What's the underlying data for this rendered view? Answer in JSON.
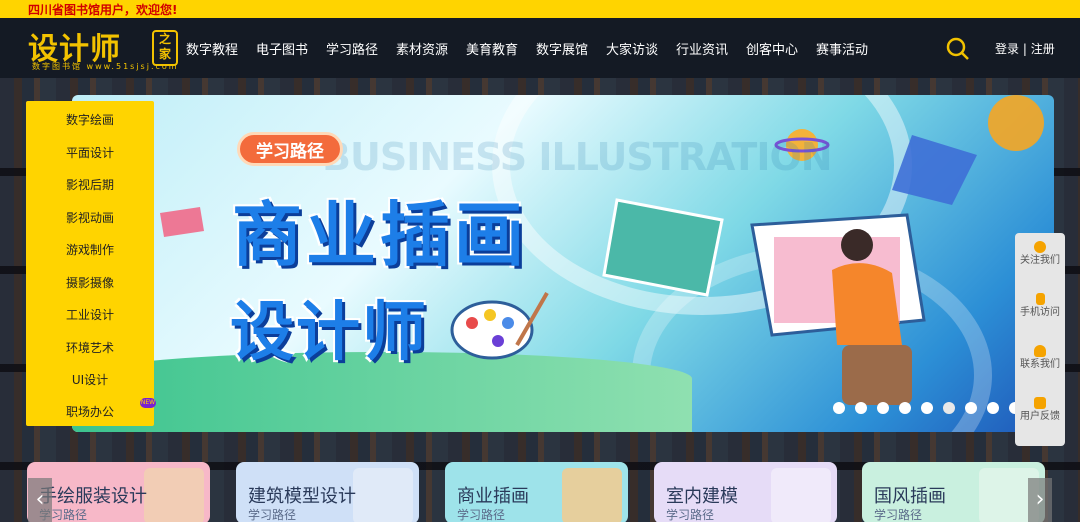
{
  "topbar": {
    "welcome": "四川省图书馆用户，欢迎您!"
  },
  "logo": {
    "main": "设计师",
    "jia": "之家",
    "sub": "数字图书馆 www.51sjsj.com"
  },
  "nav": [
    "数字教程",
    "电子图书",
    "学习路径",
    "素材资源",
    "美育教育",
    "数字展馆",
    "大家访谈",
    "行业资讯",
    "创客中心",
    "赛事活动"
  ],
  "auth": {
    "login": "登录",
    "separator": "|",
    "register": "注册"
  },
  "categories": [
    "数字绘画",
    "平面设计",
    "影视后期",
    "影视动画",
    "游戏制作",
    "摄影摄像",
    "工业设计",
    "环境艺术",
    "UI设计",
    "职场办公"
  ],
  "new_badge": "NEW",
  "banner": {
    "tag": "学习路径",
    "ghost": "BUSINESS ILLUSTRATION",
    "title_line1": "商业插画",
    "title_line2": "设计师",
    "slides": 9,
    "active_slide": 5
  },
  "floatbar": [
    {
      "icon": "chat-icon",
      "label": "关注我们"
    },
    {
      "icon": "phone-icon",
      "label": "手机访问"
    },
    {
      "icon": "user-icon",
      "label": "联系我们"
    },
    {
      "icon": "clipboard-icon",
      "label": "用户反馈"
    }
  ],
  "cards": [
    {
      "title": "手绘服装设计",
      "sub": "学习路径",
      "color": "#f7b8c8"
    },
    {
      "title": "建筑模型设计",
      "sub": "学习路径",
      "color": "#cfe0f7"
    },
    {
      "title": "商业插画",
      "sub": "学习路径",
      "color": "#9ee3ea"
    },
    {
      "title": "室内建模",
      "sub": "学习路径",
      "color": "#e6dcf7"
    },
    {
      "title": "国风插画",
      "sub": "学习路径",
      "color": "#c9f0df"
    }
  ],
  "colors": {
    "accent": "#ffd400",
    "header": "#141a24",
    "welcome_text": "#d10000",
    "title_blue": "#1d7ee8"
  }
}
